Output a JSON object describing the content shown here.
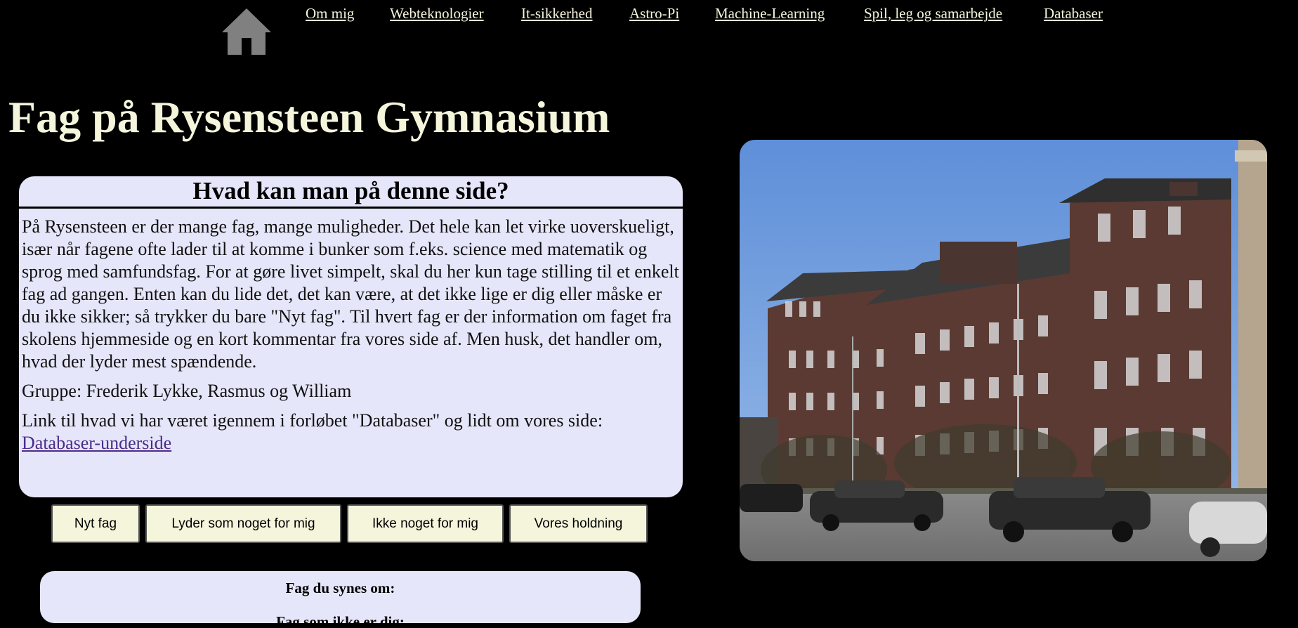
{
  "nav": {
    "home_label": "home-icon",
    "items": [
      {
        "label": "Om mig"
      },
      {
        "label": "Webteknologier"
      },
      {
        "label": "It-sikkerhed"
      },
      {
        "label": "Astro-Pi"
      },
      {
        "label": "Machine-Learning"
      },
      {
        "label": "Spil, leg og samarbejde"
      },
      {
        "label": "Databaser"
      }
    ]
  },
  "page": {
    "title": "Fag på Rysensteen Gymnasium"
  },
  "info": {
    "heading": "Hvad kan man på denne side?",
    "paragraph1": "På Rysensteen er der mange fag, mange muligheder. Det hele kan let virke uoverskueligt, især når fagene ofte lader til at komme i bunker som f.eks. science med matematik og sprog med samfundsfag. For at gøre livet simpelt, skal du her kun tage stilling til et enkelt fag ad gangen. Enten kan du lide det, det kan være, at det ikke lige er dig eller måske er du ikke sikker; så trykker du bare \"Nyt fag\". Til hvert fag er der information om faget fra skolens hjemmeside og en kort kommentar fra vores side af. Men husk, det handler om, hvad der lyder mest spændende.",
    "paragraph2": "Gruppe: Frederik Lykke, Rasmus og William",
    "paragraph3": "Link til hvad vi har været igennem i forløbet \"Databaser\" og lidt om vores side:",
    "link_label": "Databaser-underside"
  },
  "buttons": {
    "new_subject": "Nyt fag",
    "sounds_good": "Lyder som noget for mig",
    "not_for_me": "Ikke noget for mig",
    "our_stance": "Vores holdning"
  },
  "lists": {
    "liked_label": "Fag du synes om:",
    "disliked_label": "Fag som ikke er dig:"
  },
  "colors": {
    "background": "#000000",
    "title": "#f5f5dc",
    "box": "#e6e6fa",
    "button": "#f5f5dc",
    "link": "#4b2c8a"
  }
}
